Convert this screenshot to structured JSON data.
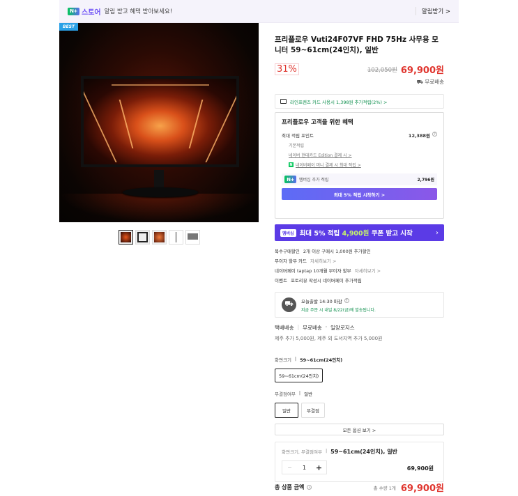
{
  "topbar": {
    "store_label": "스토어",
    "message": "알림 받고 혜택 받아보세요!",
    "alarm_link": "알림받기 >"
  },
  "image": {
    "badge": "BEST"
  },
  "product": {
    "title": "프리플로우 Vuti24F07VF FHD 75Hz 사무용 모니터 59~61cm(24인치), 일반",
    "discount": "31%",
    "original_price": "102,050원",
    "sale_price": "69,900원",
    "shipping": "무료배송"
  },
  "card_promo": "라인프렌즈 카드 사용시 1,398원 추가적립(2%) >",
  "benefits": {
    "title": "프리플로우 고객을 위한 혜택",
    "max_points_label": "최대 적립 포인트",
    "max_points_value": "12,388원",
    "sub_items": [
      {
        "label": "기본적립"
      },
      {
        "label": "네이버 현대카드 Edition 결제 시 >"
      },
      {
        "label": "네이버페이 머니 결제 시 최대 적립 >"
      }
    ],
    "membership_label": "멤버십 추가 적립",
    "membership_value": "2,796원",
    "membership_button": "최대 5% 적립 시작하기 >"
  },
  "coupon_banner": {
    "badge": "멤버십",
    "text_prefix": "최대 5% 적립",
    "text_highlight": "4,900원",
    "text_suffix": "쿠폰 받고 시작",
    "arrow": "›"
  },
  "extras": [
    {
      "label": "복수구매할인",
      "value": "2개 이상 구매시 1,000원 추가할인",
      "more": ""
    },
    {
      "label": "무이자 할부 카드",
      "value": "",
      "more": "자세히보기 >"
    },
    {
      "label": "네이버페이 taptap 10개월 무이자 할부",
      "value": "",
      "more": "자세히보기 >"
    },
    {
      "label": "이벤트",
      "value": "포토리뷰 작성시 네이버페이 추가적립",
      "more": ""
    }
  ],
  "delivery": {
    "line1": "오늘출발 14:30 마감",
    "line2": "지금 주문 시 내일 8/22(금)에 발송됩니다."
  },
  "ship_info": {
    "type": "택배배송",
    "cost": "무료배송",
    "courier": "일양로지스",
    "extra_cost": "제주 추가 5,000원, 제주 외 도서지역 추가 5,000원"
  },
  "options": {
    "size_label": "화면크기",
    "size_value": "59~61cm(24인치)",
    "size_button": "59~61cm(24인치)",
    "type_label": "무결점여부",
    "type_value": "일반",
    "type_buttons": [
      "일반",
      "무결점"
    ],
    "all_options": "모든 옵션 보기 >"
  },
  "selected": {
    "label": "화면크기, 무결점여부",
    "value": "59~61cm(24인치), 일반",
    "minus": "−",
    "qty": "1",
    "plus": "+",
    "price": "69,900원"
  },
  "total": {
    "label": "총 상품 금액",
    "count": "총 수량 1개",
    "price": "69,900원"
  },
  "colors": {
    "accent": "#5b3be6",
    "price_red": "#e0362f",
    "naver_green": "#04c75a"
  }
}
